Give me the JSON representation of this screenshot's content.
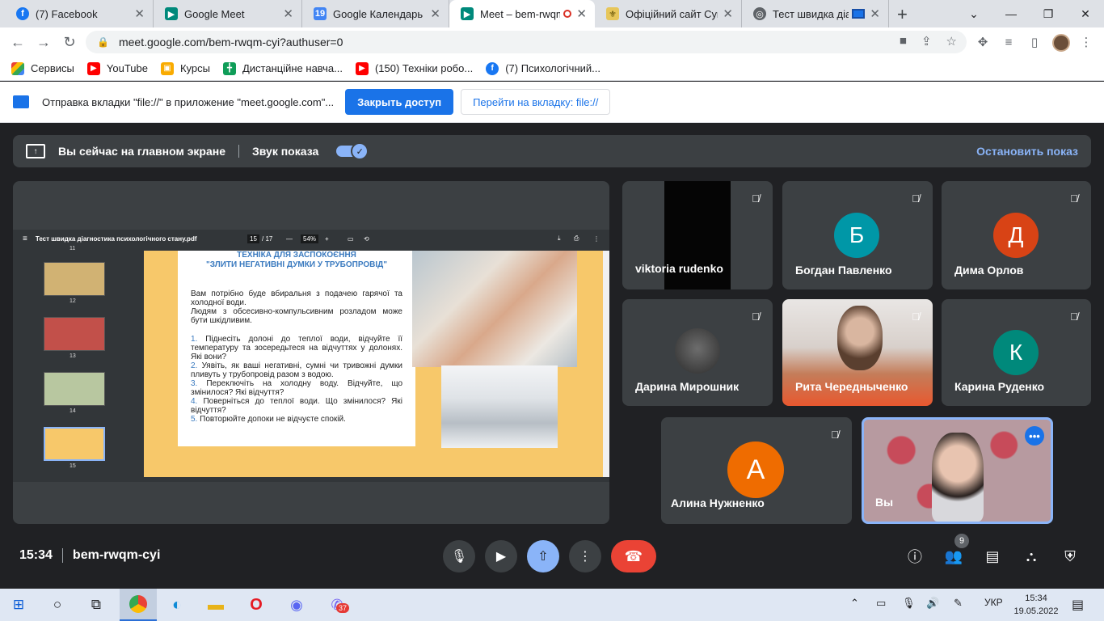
{
  "browser": {
    "tabs": [
      {
        "title": "(7) Facebook",
        "icon": "facebook-icon"
      },
      {
        "title": "Google Meet",
        "icon": "meet-icon"
      },
      {
        "title": "Google Календарь - с",
        "icon": "calendar-icon"
      },
      {
        "title": "Meet – bem-rwqm",
        "icon": "meet-icon",
        "active": true
      },
      {
        "title": "Офіційний сайт Сумс",
        "icon": "crest-icon"
      },
      {
        "title": "Тест швидка діаг",
        "icon": "globe-icon"
      }
    ],
    "url": "meet.google.com/bem-rwqm-cyi?authuser=0",
    "bookmarks": [
      {
        "label": "Сервисы",
        "icon": "apps-grid-icon"
      },
      {
        "label": "YouTube",
        "icon": "youtube-icon"
      },
      {
        "label": "Курсы",
        "icon": "classroom-icon"
      },
      {
        "label": "Дистанційне навча...",
        "icon": "sheets-icon"
      },
      {
        "label": "(150) Техніки робо...",
        "icon": "youtube-icon"
      },
      {
        "label": "(7) Психологічний...",
        "icon": "facebook-icon"
      }
    ],
    "infobar": {
      "text": "Отправка вкладки \"file://\" в приложение \"meet.google.com\"...",
      "close_access": "Закрыть доступ",
      "go_to_tab": "Перейти на вкладку: file://"
    }
  },
  "meet": {
    "banner": {
      "presenting_text": "Вы сейчас на главном экране",
      "sound_label": "Звук показа",
      "stop_label": "Остановить показ"
    },
    "pdf": {
      "filename": "Тест швидка діагностика психологічного стану.pdf",
      "page_current": "15",
      "page_total": "/ 17",
      "zoom": "54%",
      "thumb_labels": [
        "11",
        "12",
        "13",
        "14",
        "15"
      ],
      "slide_title_line1": "ТЕХНІКА ДЛЯ ЗАСПОКОЄННЯ",
      "slide_title_line2": "\"ЗЛИТИ НЕГАТИВНІ ДУМКИ У ТРУБОПРОВІД\"",
      "intro": "Вам потрібно буде вбиральня з подачею гарячої та холодної води.",
      "intro2": "Людям з обсесивно-компульсивним розладом може бути шкідливим.",
      "steps": [
        {
          "n": "1.",
          "text": "Піднесіть долоні до теплої води, відчуйте її температуру та зосередьтеся на відчуттях у долонях. Які вони?"
        },
        {
          "n": "2.",
          "text": "Уявіть, як ваші негативні, сумні чи тривожні думки пливуть у трубопровід разом з водою."
        },
        {
          "n": "3.",
          "text": "Переключіть на холодну воду. Відчуйте, що змінилося? Які відчуття?"
        },
        {
          "n": "4.",
          "text": "Поверніться до теплої води. Що змінилося? Які відчуття?"
        },
        {
          "n": "5.",
          "text": "Повторюйте допоки не відчуєте спокій."
        }
      ]
    },
    "participants": [
      {
        "name": "viktoria rudenko",
        "type": "video-dark"
      },
      {
        "name": "Богдан Павленко",
        "initial": "Б",
        "color": "#0097a7"
      },
      {
        "name": "Дима Орлов",
        "initial": "Д",
        "color": "#d84315"
      },
      {
        "name": "Дарина Мирошник",
        "type": "photo"
      },
      {
        "name": "Рита Чередныченко",
        "type": "video"
      },
      {
        "name": "Карина Руденко",
        "initial": "К",
        "color": "#00897b"
      },
      {
        "name": "Алина Нужненко",
        "initial": "А",
        "color": "#ef6c00"
      },
      {
        "name": "Вы",
        "type": "self-video"
      }
    ],
    "meeting_time": "15:34",
    "meeting_code": "bem-rwqm-cyi",
    "people_count": "9"
  },
  "taskbar": {
    "lang": "УКР",
    "time": "15:34",
    "date": "19.05.2022",
    "viber_badge": "37"
  }
}
